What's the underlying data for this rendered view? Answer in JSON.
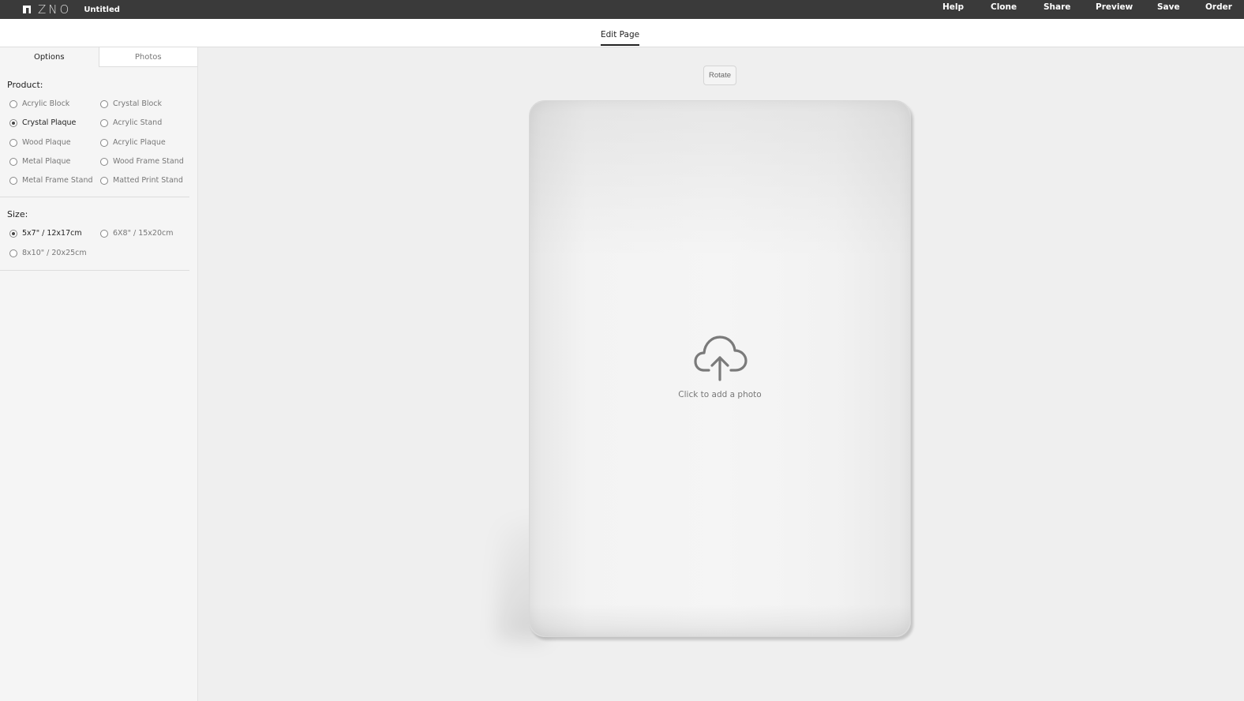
{
  "app": {
    "logo_text": "ZNO",
    "document_title": "Untitled"
  },
  "topnav": {
    "items": [
      "Help",
      "Clone",
      "Share",
      "Preview",
      "Save",
      "Order"
    ]
  },
  "subbar": {
    "active_tab": "Edit Page"
  },
  "sidebar": {
    "tabs": [
      {
        "label": "Options",
        "active": true
      },
      {
        "label": "Photos",
        "active": false
      }
    ],
    "product": {
      "title": "Product:",
      "options": [
        {
          "label": "Acrylic Block",
          "selected": false
        },
        {
          "label": "Crystal Block",
          "selected": false
        },
        {
          "label": "Crystal Plaque",
          "selected": true
        },
        {
          "label": "Acrylic Stand",
          "selected": false
        },
        {
          "label": "Wood Plaque",
          "selected": false
        },
        {
          "label": "Acrylic Plaque",
          "selected": false
        },
        {
          "label": "Metal Plaque",
          "selected": false
        },
        {
          "label": "Wood Frame Stand",
          "selected": false
        },
        {
          "label": "Metal Frame Stand",
          "selected": false
        },
        {
          "label": "Matted Print Stand",
          "selected": false
        }
      ]
    },
    "size": {
      "title": "Size:",
      "options": [
        {
          "label": "5x7\" / 12x17cm",
          "selected": true
        },
        {
          "label": "6X8\" / 15x20cm",
          "selected": false
        },
        {
          "label": "8x10\" / 20x25cm",
          "selected": false
        }
      ]
    }
  },
  "canvas": {
    "rotate_label": "Rotate",
    "upload_prompt": "Click to add a photo",
    "upload_icon": "cloud-upload-icon"
  }
}
